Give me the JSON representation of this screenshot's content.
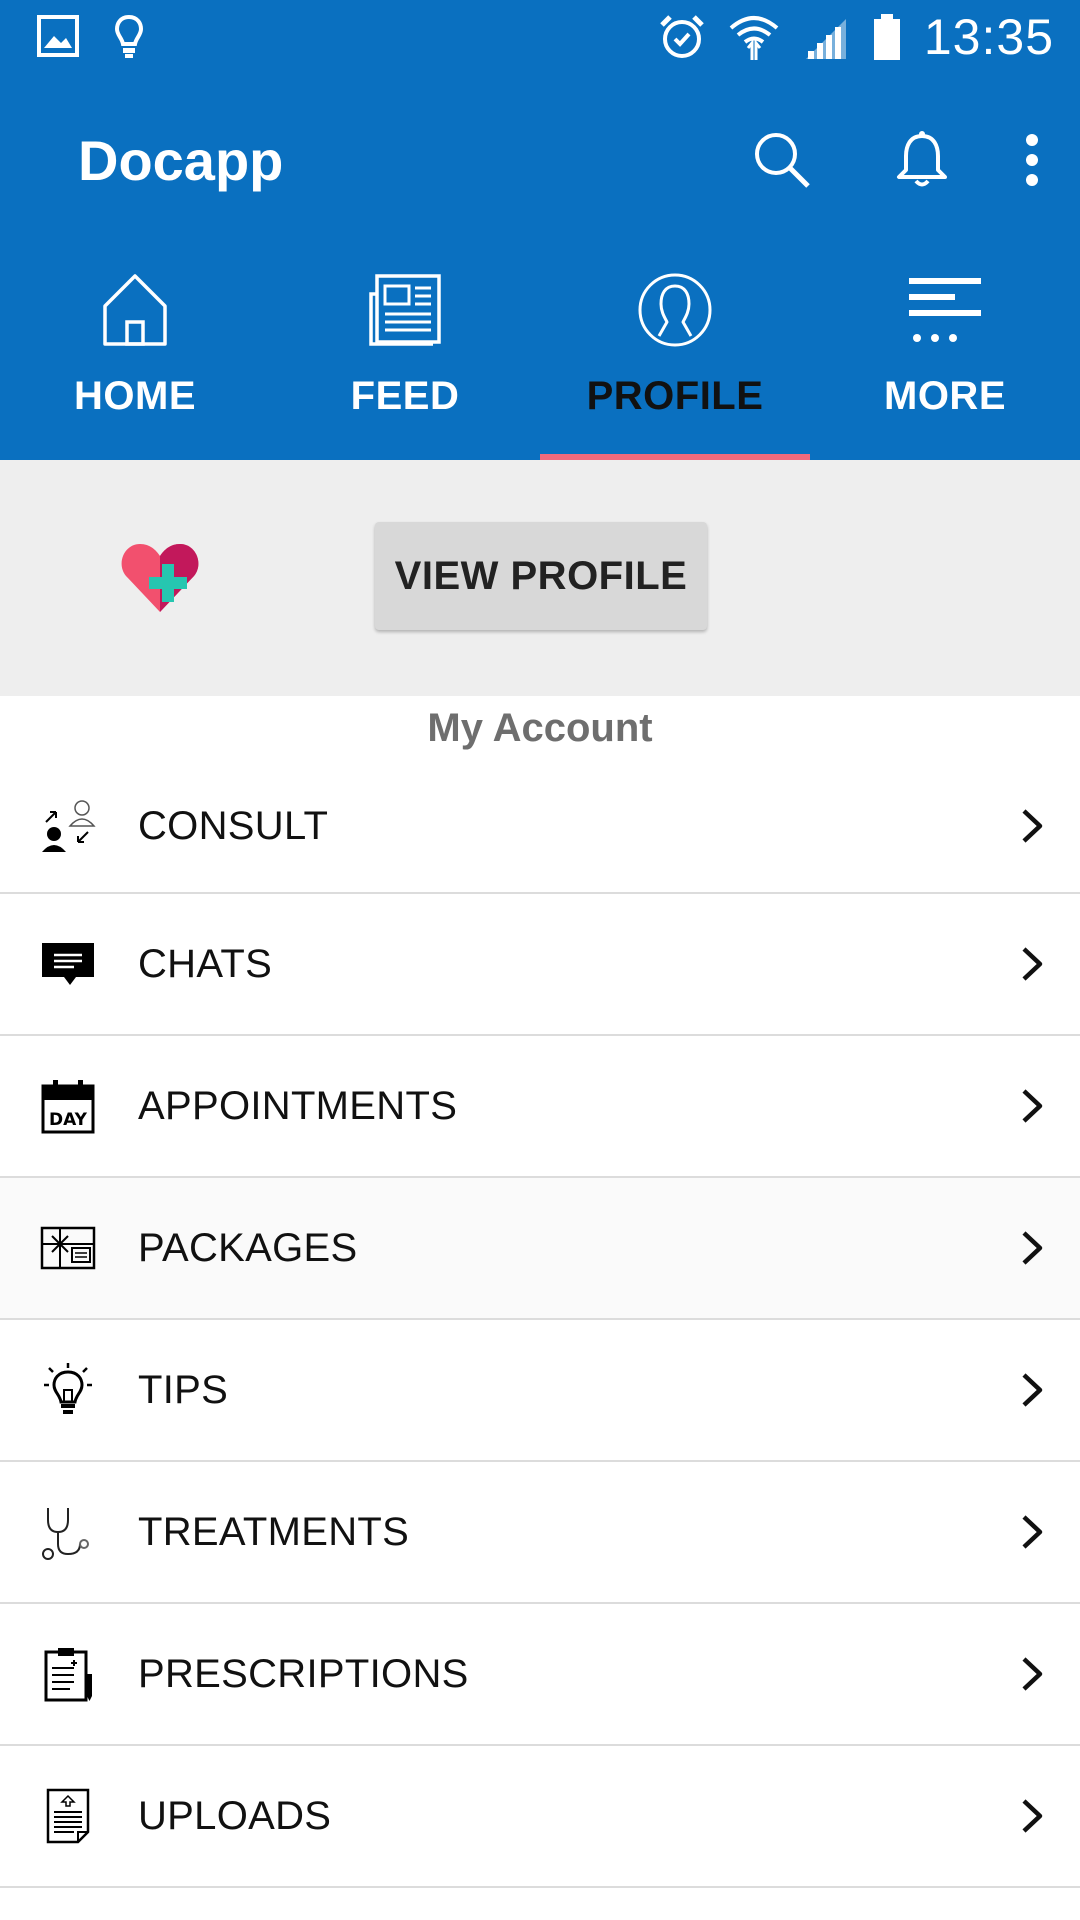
{
  "status_bar": {
    "time": "13:35",
    "icons": [
      "image-icon",
      "lightbulb-icon",
      "alarm-icon",
      "wifi-icon",
      "signal-icon",
      "battery-icon"
    ]
  },
  "toolbar": {
    "title": "Docapp",
    "actions": [
      "search-icon",
      "bell-icon",
      "overflow-menu-icon"
    ]
  },
  "tabs": [
    {
      "label": "HOME",
      "icon": "home-icon",
      "active": false
    },
    {
      "label": "FEED",
      "icon": "feed-icon",
      "active": false
    },
    {
      "label": "PROFILE",
      "icon": "profile-icon",
      "active": true
    },
    {
      "label": "MORE",
      "icon": "more-icon",
      "active": false
    }
  ],
  "profile_header": {
    "logo": "heart-plus-logo",
    "view_profile_label": "VIEW PROFILE"
  },
  "section_title": "My Account",
  "menu": [
    {
      "label": "CONSULT",
      "icon": "consult-icon"
    },
    {
      "label": "CHATS",
      "icon": "chat-icon"
    },
    {
      "label": "APPOINTMENTS",
      "icon": "calendar-day-icon"
    },
    {
      "label": "PACKAGES",
      "icon": "package-icon"
    },
    {
      "label": "TIPS",
      "icon": "lightbulb-icon"
    },
    {
      "label": "TREATMENTS",
      "icon": "stethoscope-icon"
    },
    {
      "label": "PRESCRIPTIONS",
      "icon": "prescription-icon"
    },
    {
      "label": "UPLOADS",
      "icon": "upload-document-icon"
    }
  ],
  "colors": {
    "primary": "#0a70c0",
    "tab_indicator": "#f06a7c",
    "header_bg": "#eeeeee"
  }
}
